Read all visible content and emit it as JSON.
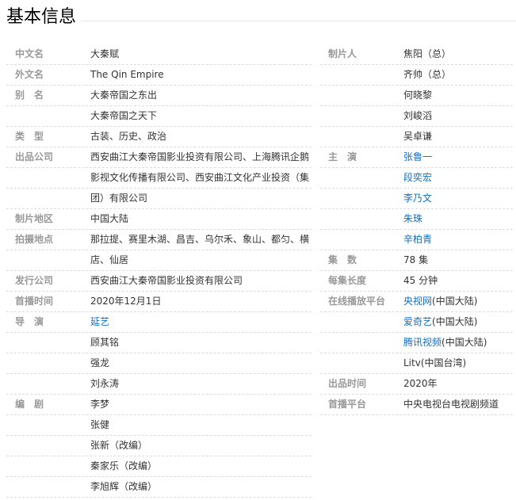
{
  "title": "基本信息",
  "left": [
    {
      "label": "中文名",
      "value": "大秦赋"
    },
    {
      "label": "外文名",
      "value": "The Qin Empire"
    },
    {
      "label": "别　名",
      "value": "大秦帝国之东出"
    },
    {
      "label": "",
      "value": "大秦帝国之天下"
    },
    {
      "label": "类　型",
      "value": "古装、历史、政治"
    },
    {
      "label": "出品公司",
      "value": "西安曲江大秦帝国影业投资有限公司、上海腾讯企鹅"
    },
    {
      "label": "",
      "value": "影视文化传播有限公司、西安曲江文化产业投资（集"
    },
    {
      "label": "",
      "value": "团）有限公司"
    },
    {
      "label": "制片地区",
      "value": "中国大陆"
    },
    {
      "label": "拍摄地点",
      "value": "那拉提、赛里木湖、昌吉、乌尔禾、象山、都匀、横"
    },
    {
      "label": "",
      "value": "店、仙居"
    },
    {
      "label": "发行公司",
      "value": "西安曲江大秦帝国影业投资有限公司"
    },
    {
      "label": "首播时间",
      "value": "2020年12月1日"
    },
    {
      "label": "导　演",
      "value": "延艺",
      "link": true
    },
    {
      "label": "",
      "value": "顾其铭"
    },
    {
      "label": "",
      "value": "强龙"
    },
    {
      "label": "",
      "value": "刘永涛"
    },
    {
      "label": "编　剧",
      "value": "李梦"
    },
    {
      "label": "",
      "value": "张健"
    },
    {
      "label": "",
      "value": "张新（改编）"
    },
    {
      "label": "",
      "value": "秦家乐（改编）"
    },
    {
      "label": "",
      "value": "李旭辉（改编）"
    }
  ],
  "right": [
    {
      "label": "制片人",
      "value": "焦阳（总）"
    },
    {
      "label": "",
      "value": "齐帅（总）"
    },
    {
      "label": "",
      "value": "何晓黎"
    },
    {
      "label": "",
      "value": "刘峻滔"
    },
    {
      "label": "",
      "value": "吴卓谦"
    },
    {
      "label": "主　演",
      "value": "张鲁一",
      "link": true
    },
    {
      "label": "",
      "value": "段奕宏",
      "link": true
    },
    {
      "label": "",
      "value": "李乃文",
      "link": true
    },
    {
      "label": "",
      "value": "朱珠",
      "link": true
    },
    {
      "label": "",
      "value": "辛柏青",
      "link": true
    },
    {
      "label": "集　数",
      "value": "78 集"
    },
    {
      "label": "每集长度",
      "value": "45 分钟"
    },
    {
      "label": "在线播放平台",
      "value_link": "央视网",
      "value_rest": "(中国大陆)"
    },
    {
      "label": "",
      "value_link": "爱奇艺",
      "value_rest": "(中国大陆)"
    },
    {
      "label": "",
      "value_link": "腾讯视频",
      "value_rest": "(中国大陆)"
    },
    {
      "label": "",
      "value": "Litv(中国台湾)"
    },
    {
      "label": "出品时间",
      "value": "2020年"
    },
    {
      "label": "首播平台",
      "value": "中央电视台电视剧频道"
    }
  ]
}
